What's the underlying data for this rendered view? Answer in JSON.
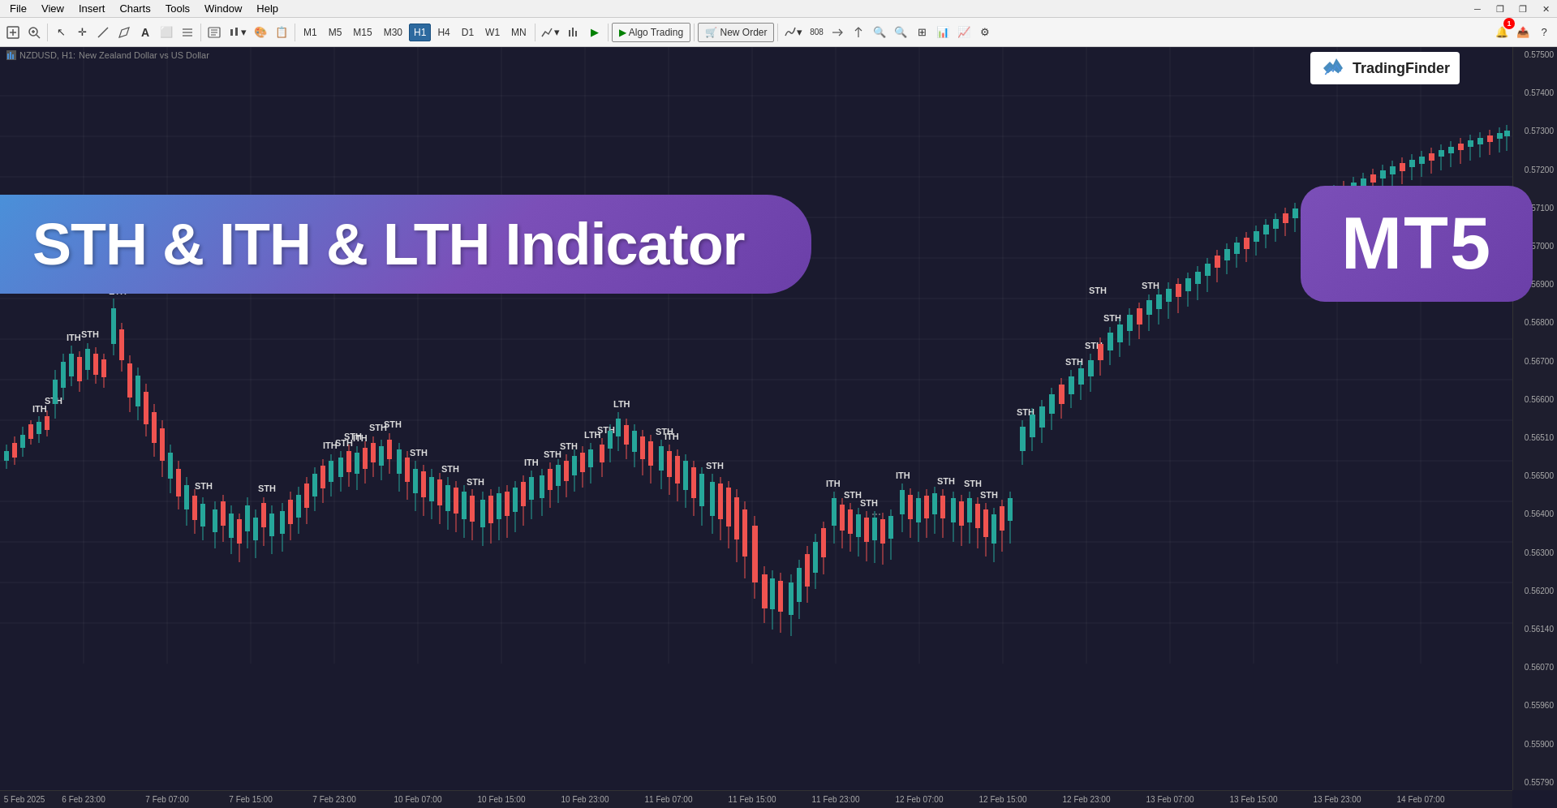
{
  "menubar": {
    "items": [
      "File",
      "View",
      "Insert",
      "Charts",
      "Tools",
      "Window",
      "Help"
    ]
  },
  "window_controls": {
    "minimize": "─",
    "maximize": "□",
    "close": "✕",
    "restore1": "❐",
    "restore2": "❐"
  },
  "toolbar": {
    "timeframes": [
      "M1",
      "M5",
      "M15",
      "M30",
      "H1",
      "H4",
      "D1",
      "W1",
      "MN"
    ],
    "active_tf": "H1",
    "algo_label": "Algo Trading",
    "new_order_label": "New Order"
  },
  "chart": {
    "symbol": "NZDUSD, H1:",
    "description": "New Zealand Dollar vs US Dollar",
    "prices": {
      "max": "0.57500",
      "levels": [
        "0.57500",
        "0.57400",
        "0.57300",
        "0.57200",
        "0.57100",
        "0.57000",
        "0.56900",
        "0.56800",
        "0.56700",
        "0.56600",
        "0.56510",
        "0.56500",
        "0.56400",
        "0.56300",
        "0.56200",
        "0.56140",
        "0.56070",
        "0.55960",
        "0.55900",
        "0.55790"
      ]
    },
    "time_labels": [
      "5 Feb 2025",
      "6 Feb 23:00",
      "7 Feb 07:00",
      "7 Feb 15:00",
      "7 Feb 23:00",
      "10 Feb 07:00",
      "10 Feb 15:00",
      "10 Feb 23:00",
      "11 Feb 07:00",
      "11 Feb 15:00",
      "11 Feb 23:00",
      "12 Feb 07:00",
      "12 Feb 15:00",
      "12 Feb 23:00",
      "13 Feb 07:00",
      "13 Feb 15:00",
      "13 Feb 23:00",
      "14 Feb 07:00"
    ]
  },
  "banner": {
    "main_title": "STH & ITH & LTH Indicator",
    "badge": "MT5"
  },
  "logo": {
    "text": "TradingFinder"
  },
  "labels": {
    "ith": "ITH",
    "sth": "STH",
    "lth": "LTH"
  }
}
